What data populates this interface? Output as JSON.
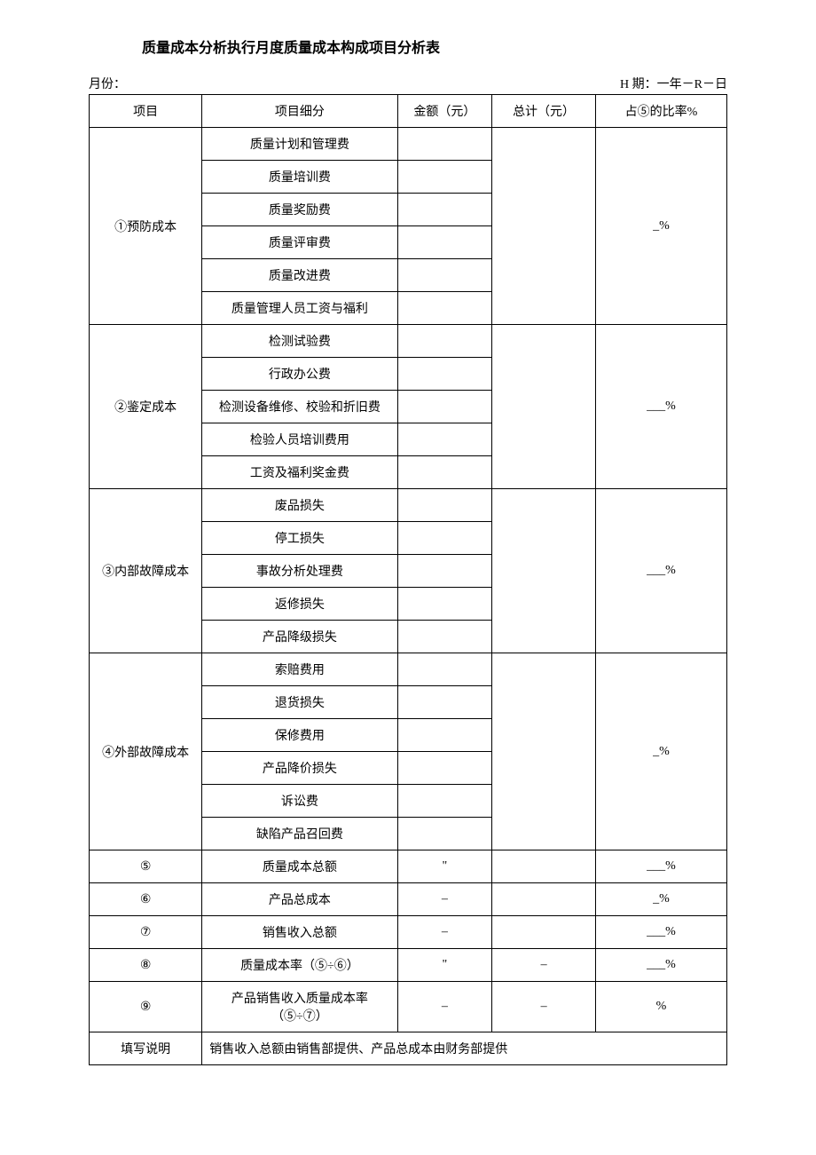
{
  "title": "质量成本分析执行月度质量成本构成项目分析表",
  "meta": {
    "month_label": "月份：",
    "date_label": "H 期：一年－R－日"
  },
  "headers": {
    "project": "项目",
    "detail": "项目细分",
    "amount": "金额（元）",
    "total": "总计（元）",
    "ratio": "占⑤的比率%"
  },
  "sections": {
    "s1": {
      "name": "①预防成本",
      "ratio": "_%",
      "items": [
        "质量计划和管理费",
        "质量培训费",
        "质量奖励费",
        "质量评审费",
        "质量改进费",
        "质量管理人员工资与福利"
      ]
    },
    "s2": {
      "name": "②鉴定成本",
      "ratio": "___%",
      "items": [
        "检测试验费",
        "行政办公费",
        "检测设备维修、校验和折旧费",
        "检验人员培训费用",
        "工资及福利奖金费"
      ]
    },
    "s3": {
      "name": "③内部故障成本",
      "ratio": "___%",
      "items": [
        "废品损失",
        "停工损失",
        "事故分析处理费",
        "返修损失",
        "产品降级损失"
      ]
    },
    "s4": {
      "name": "④外部故障成本",
      "ratio": "_%",
      "items": [
        "索赔费用",
        "退货损失",
        "保修费用",
        "产品降价损失",
        "诉讼费",
        "缺陷产品召回费"
      ]
    }
  },
  "summary": {
    "r5": {
      "num": "⑤",
      "label": "质量成本总额",
      "amount": "\"",
      "total": "",
      "ratio": "___%"
    },
    "r6": {
      "num": "⑥",
      "label": "产品总成本",
      "amount": "–",
      "total": "",
      "ratio": "_%"
    },
    "r7": {
      "num": "⑦",
      "label": "销售收入总额",
      "amount": "–",
      "total": "",
      "ratio": "___%"
    },
    "r8": {
      "num": "⑧",
      "label": "质量成本率（⑤÷⑥）",
      "amount": "\"",
      "total": "–",
      "ratio": "___%"
    },
    "r9": {
      "num": "⑨",
      "label": "产品销售收入质量成本率（⑤÷⑦）",
      "amount": "–",
      "total": "–",
      "ratio": "%"
    }
  },
  "note": {
    "label": "填写说明",
    "text": "销售收入总额由销售部提供、产品总成本由财务部提供"
  }
}
